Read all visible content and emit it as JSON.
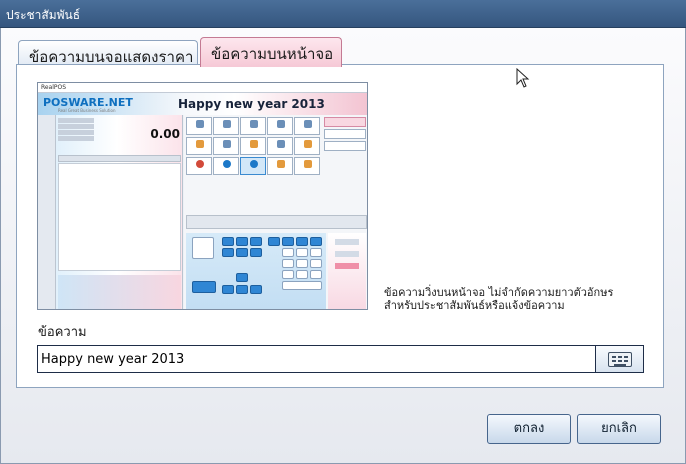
{
  "window": {
    "title": "ประชาสัมพันธ์"
  },
  "tabs": [
    {
      "label": "ข้อความบนจอแสดงราคา"
    },
    {
      "label": "ข้อความบนหน้าจอ"
    }
  ],
  "preview": {
    "window_title": "RealPOS",
    "logo": "POSWARE.NET",
    "logo_sub": "Real Great Business Solution",
    "marquee": "Happy new year 2013",
    "total": "0.00"
  },
  "description": {
    "line1": "ข้อความวิ่งบนหน้าจอ ไม่จำกัดความยาวตัวอักษร",
    "line2": "สำหรับประชาสัมพันธ์หรือแจ้งข้อความ"
  },
  "message": {
    "label": "ข้อความ",
    "value": "Happy new year 2013"
  },
  "buttons": {
    "ok": "ตกลง",
    "cancel": "ยกเลิก"
  },
  "colors": {
    "titlebar": "#3f6390",
    "tab_active": "#f6c9d6",
    "accent": "#2f86d4"
  }
}
